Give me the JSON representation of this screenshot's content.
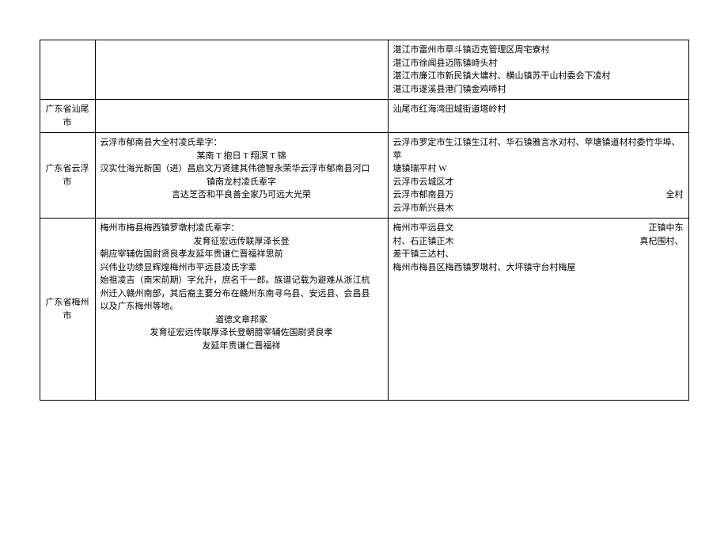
{
  "rows": [
    {
      "region": "",
      "middle": [],
      "right": [
        "湛江市雷州市草斗镇迈克管理区周宅寮村",
        "湛江市徐闻县迈陈镇峙头村",
        "湛江市廉江市新民镇大墉村、横山镇苏干山村委会下凌村",
        "湛江市遂溪县港门镇金鸡啼村"
      ]
    },
    {
      "region": "广东省汕尾市",
      "middle": [],
      "right": [
        "汕尾市红海湾田城街道塔岭村"
      ]
    },
    {
      "region": "广东省云浮市",
      "middle_lines": [
        {
          "text": "云浮市郁南县大全村凌氏辈字：",
          "align": "left"
        },
        {
          "text": "某南 T 抱日 T 翔溟 T 锦",
          "align": "center"
        },
        {
          "text": "汉实仕海光新国（进）昌启文万贤建其伟德智永荣华云浮市郁南县河口",
          "align": "left"
        },
        {
          "text": "镇南龙村凌氏辈字",
          "align": "center"
        },
        {
          "text": "言达芝否和平良善全家乃可远大光荣",
          "align": "center"
        }
      ],
      "right_lines": [
        {
          "left": "云浮市罗定市生江镇生江村、华石镇雅言水对村、苹塘镇道材村委竹华埠、苹",
          "right": ""
        },
        {
          "left": "塘镇瑞平村 W",
          "right": ""
        },
        {
          "left": "云浮市云城区才",
          "right": ""
        },
        {
          "left": "云浮市郁南县万",
          "right": "全村"
        },
        {
          "left": "云浮市新兴县木",
          "right": ""
        }
      ]
    },
    {
      "region": "广东省梅州市",
      "middle_lines": [
        {
          "text": "梅州市梅县梅西镇罗墩村凌氏辈字：",
          "align": "left"
        },
        {
          "text": "发育征宏远传联厚泽长登",
          "align": "center"
        },
        {
          "text": "朝应宰辅佐国尉贤良孝友延年贵谦仁晋福祥思前",
          "align": "left"
        },
        {
          "text": "兴伟业功绩显辉煌梅州市平远县凌氏字辈",
          "align": "left"
        },
        {
          "text": "始祖凌吉（南宋前期）字允升，庶名千一郎。族谱记载为避难从浙江杭",
          "align": "left"
        },
        {
          "text": "州迁入赣州南部，其后裔主要分布在赣州东南寻乌县、安远县、会昌县",
          "align": "left"
        },
        {
          "text": "以及广东梅州等地。",
          "align": "left"
        },
        {
          "text": "道德文章邦家",
          "align": "center"
        },
        {
          "text": "发育征宏远传联厚泽长登朝腊宰辅佐国尉贤良孝",
          "align": "center"
        },
        {
          "text": "友延年贵谦仁晋福祥",
          "align": "center"
        }
      ],
      "right_lines": [
        {
          "left": "梅州市平远县文",
          "right": "正镇中东"
        },
        {
          "left": "村、石正镇正木",
          "right": "真杞围村、"
        },
        {
          "left": "差干镇三达村、",
          "right": ""
        },
        {
          "left": "梅州市梅县区梅西镇罗墩村、大坪镇守台村梅屋",
          "right": ""
        }
      ]
    }
  ]
}
